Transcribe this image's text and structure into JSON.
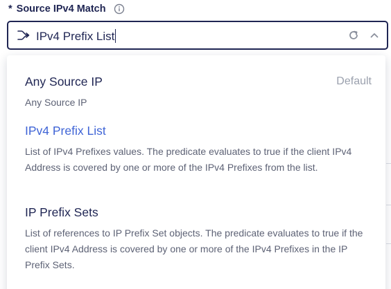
{
  "field": {
    "required_mark": "*",
    "label": "Source IPv4 Match",
    "info_icon": "info-circle-icon",
    "selected_value": "IPv4 Prefix List",
    "leading_icon": "branch-merge-icon",
    "refresh_icon": "refresh-icon",
    "toggle_icon": "chevron-up-icon"
  },
  "options": [
    {
      "title": "Any Source IP",
      "badge": "Default",
      "description": "Any Source IP",
      "selected": false
    },
    {
      "title": "IPv4 Prefix List",
      "badge": "",
      "description": "List of IPv4 Prefixes values. The predicate evaluates to true if the client IPv4 Address is covered by one or more of the IPv4 Prefixes from the list.",
      "selected": true
    },
    {
      "title": "IP Prefix Sets",
      "badge": "",
      "description": "List of references to IP Prefix Set objects. The predicate evaluates to true if the client IPv4 Address is covered by one or more of the IPv4 Prefixes in the IP Prefix Sets.",
      "selected": false
    }
  ],
  "colors": {
    "text_dark": "#1f2553",
    "accent": "#3f64d6",
    "muted": "#5d6275",
    "badge": "#9aa0ad"
  }
}
